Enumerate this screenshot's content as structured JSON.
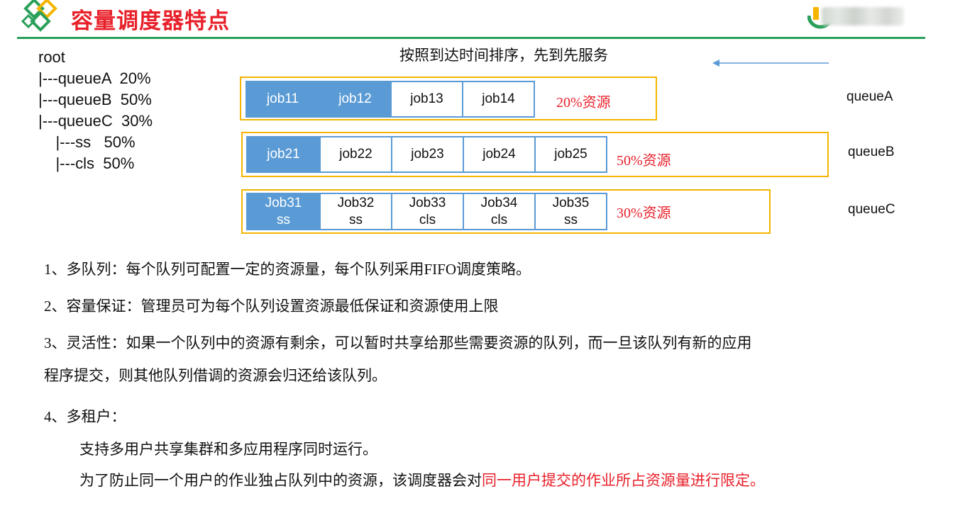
{
  "header": {
    "title": "容量调度器特点"
  },
  "tree": {
    "lines": [
      "root",
      "|---queueA  20%",
      "|---queueB  50%",
      "|---queueC  30%",
      "    |---ss   50%",
      "    |---cls  50%"
    ]
  },
  "order_text": "按照到达时间排序，先到先服务",
  "queues": [
    {
      "label": "queueA",
      "resource": "20%资源",
      "jobs": [
        {
          "line1": "job11",
          "line2": "",
          "running": true
        },
        {
          "line1": "job12",
          "line2": "",
          "running": true
        },
        {
          "line1": "job13",
          "line2": "",
          "running": false
        },
        {
          "line1": "job14",
          "line2": "",
          "running": false
        }
      ]
    },
    {
      "label": "queueB",
      "resource": "50%资源",
      "jobs": [
        {
          "line1": "job21",
          "line2": "",
          "running": true
        },
        {
          "line1": "job22",
          "line2": "",
          "running": false
        },
        {
          "line1": "job23",
          "line2": "",
          "running": false
        },
        {
          "line1": "job24",
          "line2": "",
          "running": false
        },
        {
          "line1": "job25",
          "line2": "",
          "running": false
        }
      ]
    },
    {
      "label": "queueC",
      "resource": "30%资源",
      "jobs": [
        {
          "line1": "Job31",
          "line2": "ss",
          "running": true
        },
        {
          "line1": "Job32",
          "line2": "ss",
          "running": false
        },
        {
          "line1": "Job33",
          "line2": "cls",
          "running": false
        },
        {
          "line1": "Job34",
          "line2": "cls",
          "running": false
        },
        {
          "line1": "Job35",
          "line2": "ss",
          "running": false
        }
      ]
    }
  ],
  "points": {
    "p1_num": "1、",
    "p1_text_a": "多队列：每个队列可配置一定的资源量，每个队列采用",
    "p1_fifo": "FIFO",
    "p1_text_b": "调度策略。",
    "p2_num": "2、",
    "p2_text": "容量保证：管理员可为每个队列设置资源最低保证和资源使用上限",
    "p3_num": "3、",
    "p3_text_a": "灵活性：如果一个队列中的资源有剩余，可以暂时共享给那些需要资源的队列，而一旦该队列有新的应用",
    "p3_text_b": "程序提交，则其他队列借调的资源会归还给该队列。",
    "p4_num": "4、",
    "p4_text": "多租户：",
    "p4_sub1": "支持多用户共享集群和多应用程序同时运行。",
    "p4_sub2_a": "为了防止同一个用户的作业独占队列中的资源，该调度器会对",
    "p4_sub2_red": "同一用户提交的作业所占资源量进行限定。"
  },
  "colors": {
    "accent_red": "#e8202a",
    "header_green": "#2aa05a",
    "queue_border": "#f4b400",
    "job_blue": "#5b9bd5"
  },
  "icons": {
    "logo": "diamond-logo-icon",
    "brand": "brand-logo-icon",
    "arrow": "left-arrow-icon"
  }
}
